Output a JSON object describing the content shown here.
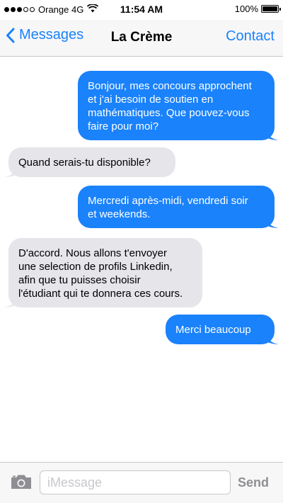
{
  "status_bar": {
    "carrier": "Orange 4G",
    "time": "11:54 AM",
    "battery": "100%",
    "battery_level": 1.0,
    "signal_bars_filled": 3,
    "signal_bars_total": 5
  },
  "nav": {
    "back_label": "Messages",
    "title": "La Crème",
    "contact_label": "Contact"
  },
  "messages": [
    {
      "direction": "outgoing",
      "lines": [
        "Bonjour, mes concours approchent",
        "et j'ai besoin de soutien en",
        "mathématiques. Que pouvez-vous",
        "faire pour moi?"
      ]
    },
    {
      "direction": "incoming",
      "lines": [
        "Quand serais-tu disponible?"
      ]
    },
    {
      "direction": "outgoing",
      "lines": [
        "Mercredi après-midi, vendredi soir",
        "et weekends."
      ]
    },
    {
      "direction": "incoming",
      "lines": [
        "D'accord. Nous allons t'envoyer",
        "une selection de profils Linkedin,",
        "afin que tu puisses choisir",
        "l'étudiant qui te donnera ces cours."
      ]
    },
    {
      "direction": "outgoing",
      "lines": [
        "Merci beaucoup"
      ]
    }
  ],
  "input": {
    "placeholder": "iMessage",
    "value": "",
    "send_label": "Send"
  },
  "icons": {
    "back": "chevron-left-icon",
    "camera": "camera-icon",
    "wifi": "wifi-icon",
    "battery": "battery-icon"
  },
  "colors": {
    "accent": "#1a82fb",
    "outgoing_bubble": "#1a82fb",
    "incoming_bubble": "#e5e5ea",
    "send_disabled": "#8e8e93"
  }
}
